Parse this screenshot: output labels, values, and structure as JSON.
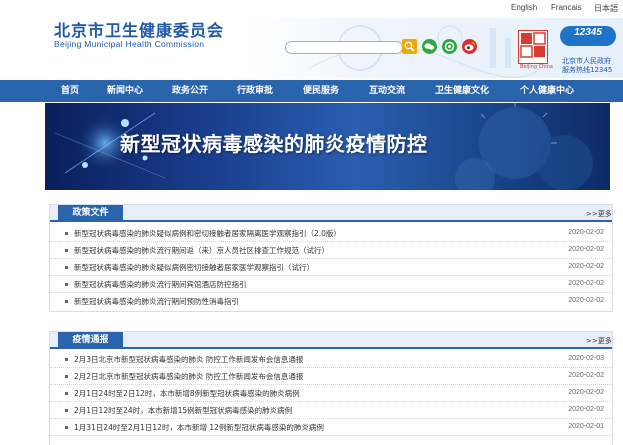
{
  "languages": [
    "English",
    "Francais",
    "日本語"
  ],
  "header": {
    "title": "北京市卫生健康委员会",
    "subtitle": "Beijing Municipal Health Commission",
    "search_placeholder": "",
    "hotline_number": "12345",
    "hotline_line1": "北京市人民政府",
    "hotline_line2": "服务热线12345",
    "logo_text": "首都之窗",
    "logo_caption": "Beijing China"
  },
  "nav": {
    "items": [
      {
        "label": "首页"
      },
      {
        "label": "新闻中心"
      },
      {
        "label": "政务公开"
      },
      {
        "label": "行政审批"
      },
      {
        "label": "便民服务"
      },
      {
        "label": "互动交流"
      },
      {
        "label": "卫生健康文化"
      },
      {
        "label": "个人健康中心"
      }
    ]
  },
  "banner": {
    "title": "新型冠状病毒感染的肺炎疫情防控"
  },
  "policy": {
    "tab_label": "政策文件",
    "more_label": ">>更多",
    "items": [
      {
        "title": "新型冠状病毒感染的肺炎疑似病例和密切接触者居家隔离医学观察指引（2.0版）",
        "date": "2020-02-02"
      },
      {
        "title": "新型冠状病毒感染的肺炎流行期间返（来）京人员社区排查工作规范（试行）",
        "date": "2020-02-02"
      },
      {
        "title": "新型冠状病毒感染的肺炎疑似病例密切接触者居家医学观察指引（试行）",
        "date": "2020-02-02"
      },
      {
        "title": "新型冠状病毒感染的肺炎流行期间宾馆酒店防控指引",
        "date": "2020-02-02"
      },
      {
        "title": "新型冠状病毒感染的肺炎流行期间预防性消毒指引",
        "date": "2020-02-02"
      }
    ]
  },
  "notice": {
    "tab_label": "疫情通报",
    "more_label": ">>更多",
    "items": [
      {
        "title": "2月3日北京市新型冠状病毒感染的肺炎 防控工作新闻发布会信息通报",
        "date": "2020-02-03"
      },
      {
        "title": "2月2日北京市新型冠状病毒感染的肺炎 防控工作新闻发布会信息通报",
        "date": "2020-02-02"
      },
      {
        "title": "2月1日24时至2日12时，本市新增8例新型冠状病毒感染的肺炎病例",
        "date": "2020-02-02"
      },
      {
        "title": "2月1日12时至24时，本市新增15例新型冠状病毒感染的肺炎病例",
        "date": "2020-02-02"
      },
      {
        "title": "1月31日24时至2月1日12时，本市新增 12例新型冠状病毒感染的肺炎病例",
        "date": "2020-02-01"
      }
    ]
  },
  "colors": {
    "brand": "#1f59a8",
    "nav": "#2a64ad",
    "banner_dark": "#0a1f5c",
    "search_button": "#f2a800",
    "logo_red": "#d53b2f"
  }
}
